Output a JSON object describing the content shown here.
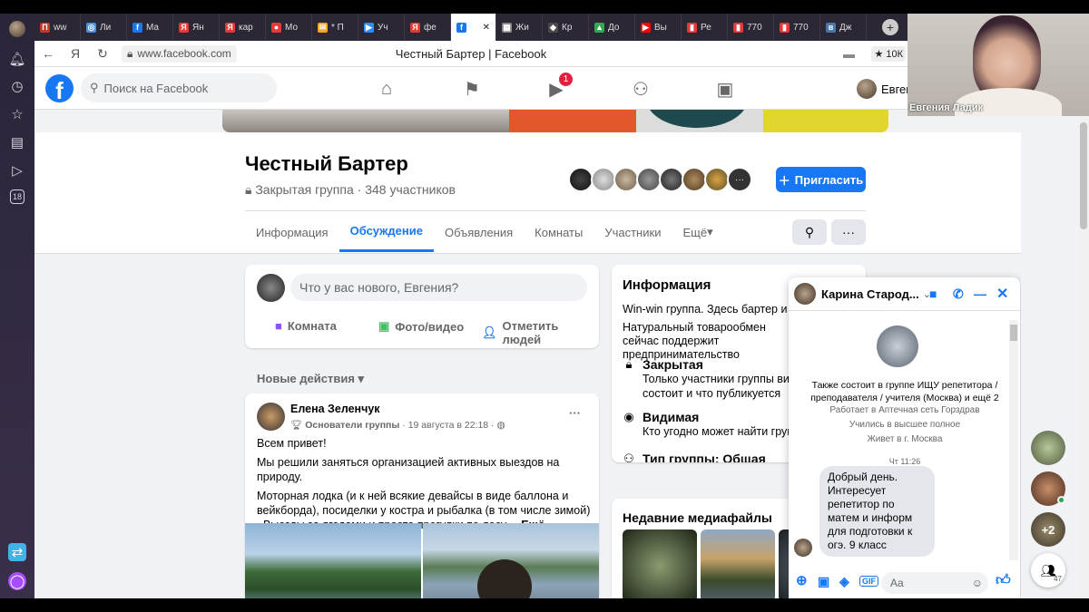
{
  "browser": {
    "tabs": [
      {
        "icon": "П",
        "label": "ww",
        "color": "#c0392b"
      },
      {
        "icon": "◎",
        "label": "Ли",
        "color": "#4a90e2"
      },
      {
        "icon": "f",
        "label": "Ma",
        "color": "#1877f2"
      },
      {
        "icon": "Я",
        "label": "Ян",
        "color": "#e53935"
      },
      {
        "icon": "Я",
        "label": "кар",
        "color": "#e53935"
      },
      {
        "icon": "●",
        "label": "Мо",
        "color": "#e53935"
      },
      {
        "icon": "✉",
        "label": "* П",
        "color": "#f5a623"
      },
      {
        "icon": "▶",
        "label": "Уч",
        "color": "#2d8cff"
      },
      {
        "icon": "Я",
        "label": "фе",
        "color": "#e53935"
      },
      {
        "icon": "f",
        "label": "",
        "color": "#1877f2",
        "active": true
      },
      {
        "icon": "▦",
        "label": "Жи",
        "color": "#888"
      },
      {
        "icon": "◆",
        "label": "Кр",
        "color": "#4a4a4a"
      },
      {
        "icon": "▲",
        "label": "До",
        "color": "#34a853"
      },
      {
        "icon": "▶",
        "label": "Вы",
        "color": "#ff0000"
      },
      {
        "icon": "▮",
        "label": "Ре",
        "color": "#e53935"
      },
      {
        "icon": "▮",
        "label": "770",
        "color": "#e53935"
      },
      {
        "icon": "▮",
        "label": "770",
        "color": "#e53935"
      },
      {
        "icon": "в",
        "label": "Дж",
        "color": "#4a76a8"
      }
    ],
    "new_tab": "+",
    "close_tab": "✕",
    "url": "www.facebook.com",
    "page_title": "Честный Бартер | Facebook",
    "stars": "★ 10К"
  },
  "fb": {
    "search_placeholder": "Поиск на Facebook",
    "video_badge": "1",
    "user_name": "Евген"
  },
  "group": {
    "name": "Честный Бартер",
    "meta": "Закрытая группа · 348 участников",
    "invite_label": "Пригласить",
    "tabs": [
      "Информация",
      "Обсуждение",
      "Объявления",
      "Комнаты",
      "Участники",
      "Ещё"
    ],
    "more_dots": "···"
  },
  "composer": {
    "placeholder": "Что у вас нового, Евгения?",
    "actions": [
      "Комната",
      "Фото/видео",
      "Отметить людей"
    ]
  },
  "feed": {
    "sort_label": "Новые действия"
  },
  "post": {
    "author": "Елена Зеленчук",
    "badge": "Основатели группы",
    "time": "· 19 августа в 22:18 ·",
    "line1": "Всем привет!",
    "line2": "Мы решили заняться организацией активных выездов на природу.",
    "line3": "Моторная лодка (и к ней всякие девайсы в виде баллона и вейкборда), посиделки у костра и рыбалка (в том числе зимой) , Выезды за ягодами и просто прогулки по лесу....",
    "more": "Ещё",
    "dots": "···"
  },
  "info": {
    "title": "Информация",
    "desc1": "Win-win группа. Здесь бартер и #а",
    "desc2": "Натуральный товарообмен сейчас поддержит предпринимательство",
    "closed_title": "Закрытая",
    "closed_text": "Только участники группы вид состоит и что публикуется",
    "visible_title": "Видимая",
    "visible_text": "Кто угодно может найти групп",
    "type_title": "Тип группы: Общая"
  },
  "media": {
    "title": "Недавние медиафайлы"
  },
  "chat": {
    "name": "Карина Старод...",
    "info1": "Также состоит в группе ИЩУ репетитора / преподавателя / учителя (Москва) и ещё 2",
    "info2": "Работает в Аптечная сеть Горздрав",
    "info3": "Учились в высшее полное",
    "info4": "Живет в г. Москва",
    "time": "Чт 11:26",
    "message": "Добрый день. Интересует репетитор по матем и информ для подготовки к огэ. 9 класс",
    "input_placeholder": "Aa",
    "gif": "GIF"
  },
  "right": {
    "more_contacts": "+2",
    "people_count": "47"
  },
  "webcam": {
    "name": "Евгения Ладик"
  },
  "colors": {
    "fb_blue": "#1877f2",
    "page_bg": "#f0f2f5",
    "badge_red": "#e41e3f"
  }
}
